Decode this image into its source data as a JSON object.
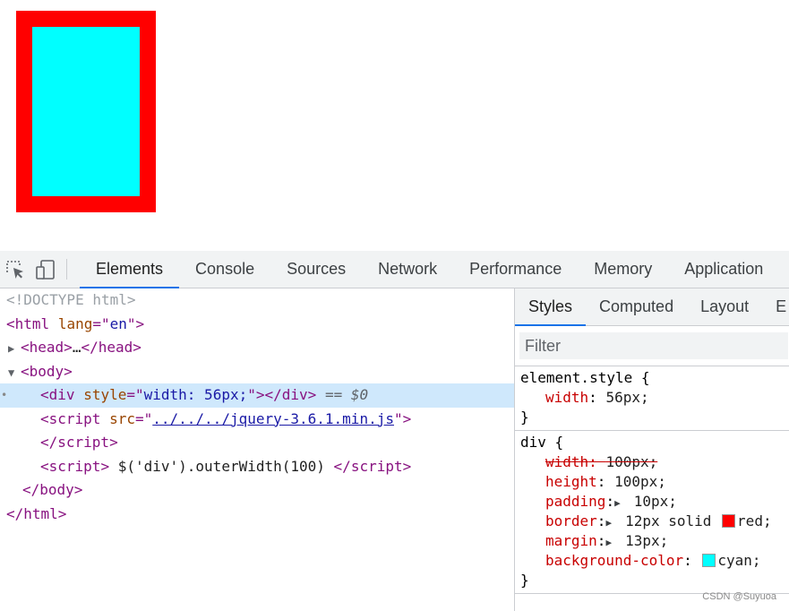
{
  "devtools": {
    "main_tabs": [
      "Elements",
      "Console",
      "Sources",
      "Network",
      "Performance",
      "Memory",
      "Application"
    ],
    "active_main_tab": "Elements",
    "dom": {
      "doctype": "<!DOCTYPE html>",
      "html_tag": "html",
      "html_attr_name": "lang",
      "html_attr_value": "en",
      "head_collapsed": "head",
      "body_tag": "body",
      "div_tag": "div",
      "div_attr_name": "style",
      "div_attr_value": "width: 56px;",
      "selected_marker": "== $0",
      "script_tag": "script",
      "script_attr_name": "src",
      "script_src": "../../../jquery-3.6.1.min.js",
      "script_inline_text": "$('div').outerWidth(100)"
    },
    "styles_tabs": [
      "Styles",
      "Computed",
      "Layout",
      "E"
    ],
    "active_styles_tab": "Styles",
    "filter_placeholder": "Filter",
    "rules": {
      "element_style": {
        "selector": "element.style {",
        "props": [
          {
            "name": "width",
            "value": "56px;"
          }
        ]
      },
      "div_rule": {
        "selector": "div {",
        "width": {
          "name": "width",
          "value": "100px;"
        },
        "height": {
          "name": "height",
          "value": "100px;"
        },
        "padding": {
          "name": "padding",
          "value": "10px;"
        },
        "border": {
          "name": "border",
          "value": "12px solid",
          "color_name": "red;"
        },
        "margin": {
          "name": "margin",
          "value": "13px;"
        },
        "background": {
          "name": "background-color",
          "color_name": "cyan;"
        }
      }
    },
    "closing_brace": "}"
  },
  "colors": {
    "border_red": "#ff0000",
    "fill_cyan": "#00ffff",
    "accent": "#1a73e8"
  },
  "watermark": "CSDN @Suyuoa"
}
